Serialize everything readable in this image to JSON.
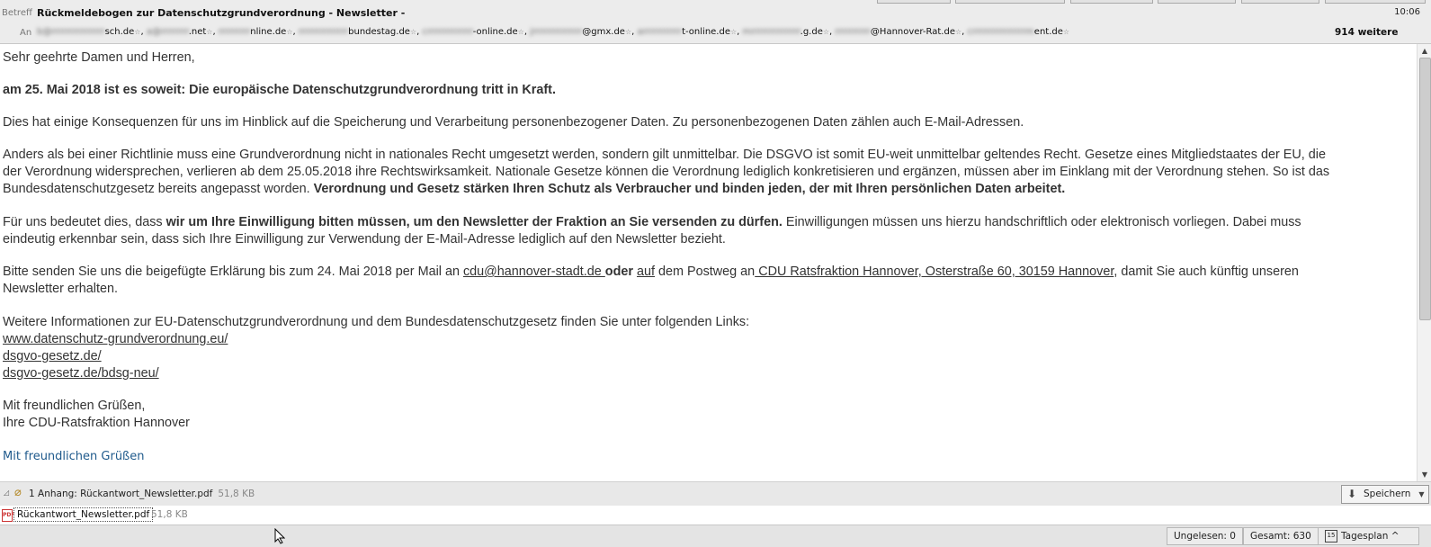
{
  "header": {
    "subject_label": "Betreff",
    "subject": "Rückmeldebogen zur Datenschutzgrundverordnung - Newsletter -",
    "time": "10:06",
    "to_label": "An",
    "recipients": [
      "b@rrrrrrrrrrrrrrrsch.de",
      "a@rrrrrrrr.net",
      "rrrrrrrrrnline.de",
      "rrrrrrrrrrrrrrbundestag.de",
      "crrrrrrrrrrrrr-online.de",
      "jrrrrrrrrrrrrrr@gmx.de",
      "arrrrrrrrrrrt-online.de",
      "mrrrrrrrrrrrrrrrg.de",
      "rrrrrrrrrr@Hannover-Rat.de",
      "crrrrrrrrrrrrrrrment.de"
    ],
    "recipient_domains": [
      "sch.de",
      ".net",
      "nline.de",
      "bundestag.de",
      "-online.de",
      "@gmx.de",
      "t-online.de",
      ".g.de",
      "@Hannover-Rat.de",
      "ent.de"
    ],
    "more_count": "914 weitere"
  },
  "body": {
    "greeting": "Sehr geehrte Damen und Herren,",
    "p1_bold": "am 25. Mai 2018 ist es soweit: Die europäische Datenschutzgrundverordnung tritt in Kraft.",
    "p2": "Dies hat einige Konsequenzen für uns im Hinblick auf die Speicherung und Verarbeitung personenbezogener Daten. Zu personenbezogenen Daten zählen auch E-Mail-Adressen.",
    "p3_l1": "Anders als bei einer Richtlinie muss eine Grundverordnung nicht in nationales Recht umgesetzt werden, sondern gilt unmittelbar. Die DSGVO ist somit EU-weit unmittelbar geltendes Recht. Gesetze eines Mitgliedstaates der EU, die",
    "p3_l2": "der Verordnung widersprechen, verlieren ab dem 25.05.2018 ihre Rechtswirksamkeit. Nationale Gesetze können die Verordnung lediglich konkretisieren und ergänzen, müssen aber im Einklang mit der Verordnung stehen. So ist das",
    "p3_l3a": "Bundesdatenschutzgesetz bereits angepasst worden. ",
    "p3_l3b": "Verordnung und Gesetz stärken Ihren Schutz als Verbraucher und binden jeden, der mit Ihren persönlichen Daten arbeitet.",
    "p4_l1a": "Für uns bedeutet dies, dass ",
    "p4_l1b": "wir um Ihre Einwilligung bitten müssen, um den Newsletter der Fraktion an Sie versenden zu dürfen.",
    "p4_l1c": " Einwilligungen müssen uns hierzu handschriftlich oder elektronisch vorliegen. Dabei muss",
    "p4_l2": "eindeutig erkennbar sein, dass sich Ihre Einwilligung zur Verwendung der E-Mail-Adresse lediglich auf den Newsletter bezieht.",
    "p5_a": "Bitte senden Sie uns die beigefügte Erklärung bis zum 24. Mai 2018 per Mail an ",
    "p5_email": "cdu@hannover-stadt.de ",
    "p5_oder": "oder",
    "p5_space": " ",
    "p5_auf": "auf",
    "p5_b": " dem Postweg an",
    "p5_addr": " CDU Ratsfraktion Hannover, Osterstraße 60, 30159 Hannover",
    "p5_c": ", damit Sie auch künftig unseren",
    "p5_l2": "Newsletter erhalten.",
    "p6": "Weitere Informationen zur EU-Datenschutzgrundverordnung und dem Bundesdatenschutzgesetz finden Sie unter folgenden Links:",
    "links": [
      "www.datenschutz-grundverordnung.eu/",
      "dsgvo-gesetz.de/",
      "dsgvo-gesetz.de/bdsg-neu/"
    ],
    "closing1": "Mit freundlichen Grüßen,",
    "closing2": "Ihre CDU-Ratsfraktion Hannover",
    "signature": "Mit freundlichen Grüßen"
  },
  "attachment": {
    "bar_title": "1 Anhang: Rückantwort_Newsletter.pdf",
    "bar_size": "51,8 KB",
    "save_label": "Speichern",
    "file_name": "Rückantwort_Newsletter.pdf",
    "file_size": "51,8 KB"
  },
  "status": {
    "unread": "Ungelesen: 0",
    "total": "Gesamt: 630",
    "calendar_day": "15",
    "today_pane": "Tagesplan"
  },
  "icons": [
    "star-icon",
    "paperclip-icon",
    "save-icon",
    "pdf-icon",
    "calendar-icon",
    "arrow-annotation"
  ]
}
